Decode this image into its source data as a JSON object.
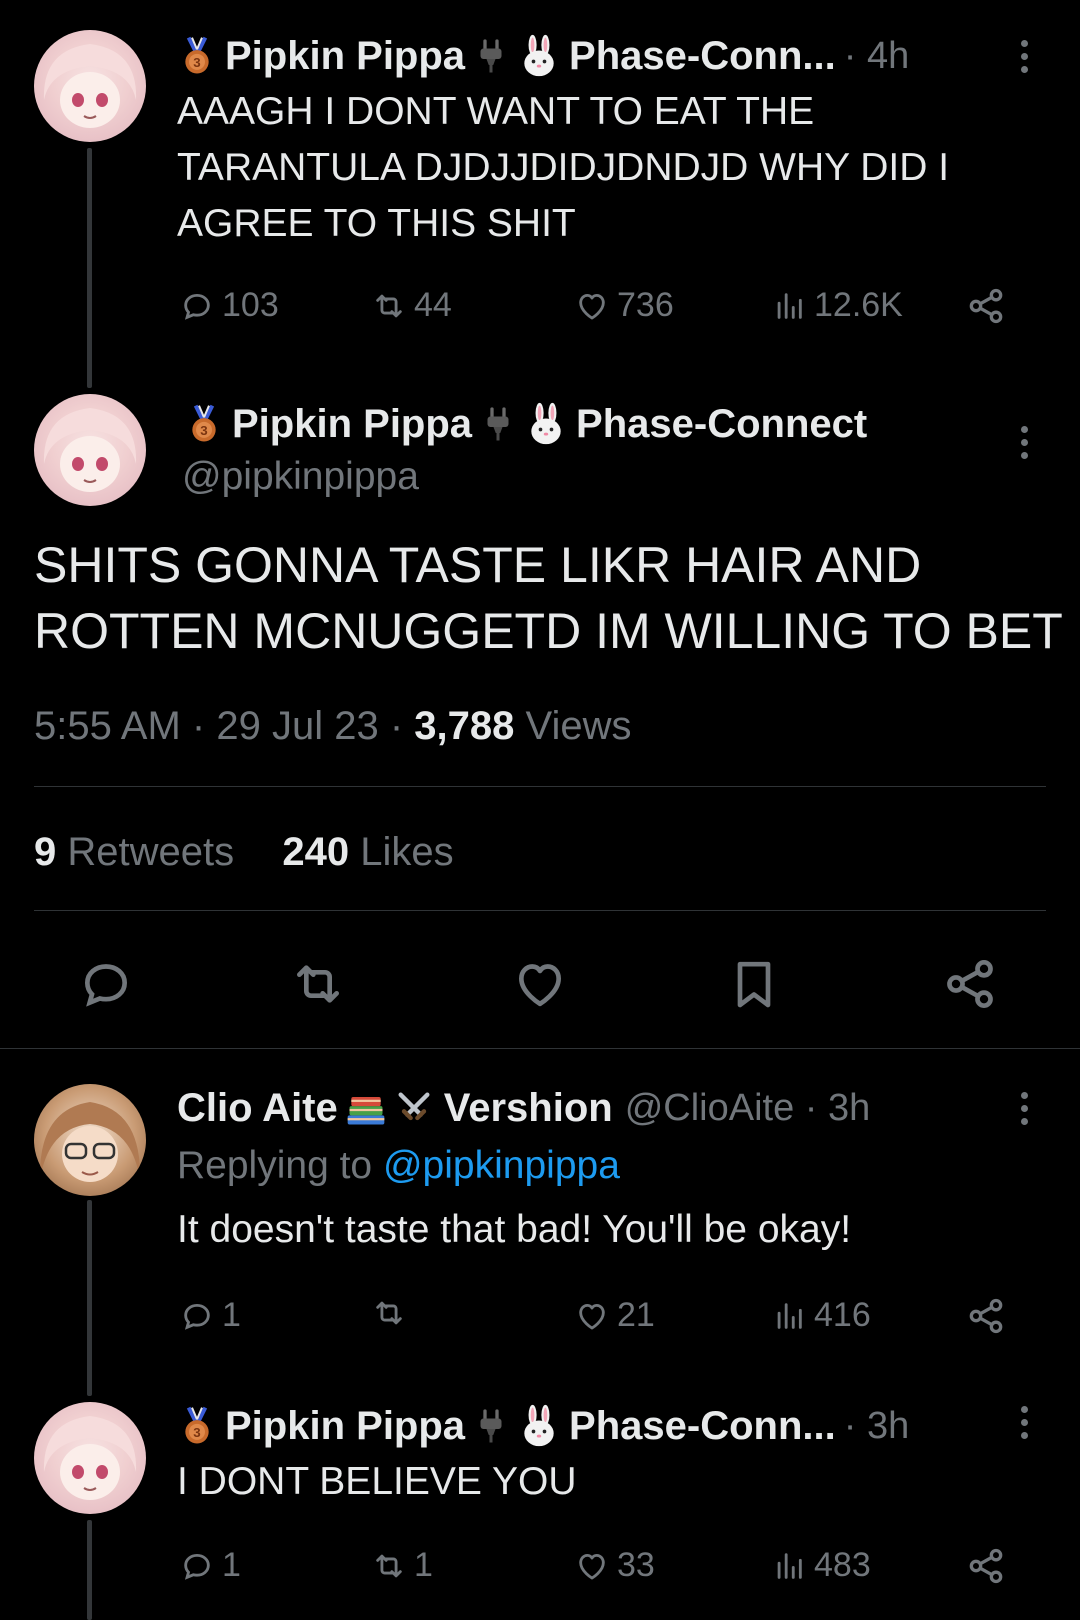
{
  "tweets": {
    "first": {
      "name": "Pipkin Pippa",
      "affiliation": "Phase-Conn...",
      "time": "· 4h",
      "text_lines": [
        "AAAGH I DONT WANT TO EAT THE",
        "TARANTULA DJDJJDIDJDNDJD WHY DID I",
        "AGREE TO THIS SHIT"
      ],
      "replies": "103",
      "retweets": "44",
      "likes": "736",
      "views": "12.6K"
    },
    "main": {
      "name": "Pipkin Pippa",
      "affiliation": "Phase-Connect",
      "handle": "@pipkinpippa",
      "text_lines": [
        "SHITS GONNA TASTE LIKR HAIR AND",
        "ROTTEN MCNUGGETD IM WILLING TO BET"
      ],
      "time": "5:55 AM",
      "date": "29 Jul 23",
      "views_count": "3,788",
      "views_label": "Views",
      "retweets_count": "9",
      "retweets_label": "Retweets",
      "likes_count": "240",
      "likes_label": "Likes",
      "dot": "·"
    },
    "reply1": {
      "name": "Clio Aite",
      "affiliation": "Vershion",
      "handle_time": "@ClioAite · 3h",
      "replying_label": "Replying to",
      "replying_handle": "@pipkinpippa",
      "text": "It doesn't taste that bad! You'll be okay!",
      "replies": "1",
      "retweets": "",
      "likes": "21",
      "views": "416"
    },
    "reply2": {
      "name": "Pipkin Pippa",
      "affiliation": "Phase-Conn...",
      "time": "· 3h",
      "text": "I DONT BELIEVE YOU",
      "replies": "1",
      "retweets": "1",
      "likes": "33",
      "views": "483"
    }
  },
  "colors": {
    "background": "#000000",
    "text": "#e7e9ea",
    "secondary": "#71767b",
    "link": "#1d9bf0",
    "divider": "#2f3336"
  },
  "icons": [
    "medal-icon",
    "plug-icon",
    "rabbit-icon",
    "books-icon",
    "swords-icon",
    "reply-icon",
    "retweet-icon",
    "like-icon",
    "views-icon",
    "share-icon",
    "bookmark-icon",
    "more-icon"
  ]
}
